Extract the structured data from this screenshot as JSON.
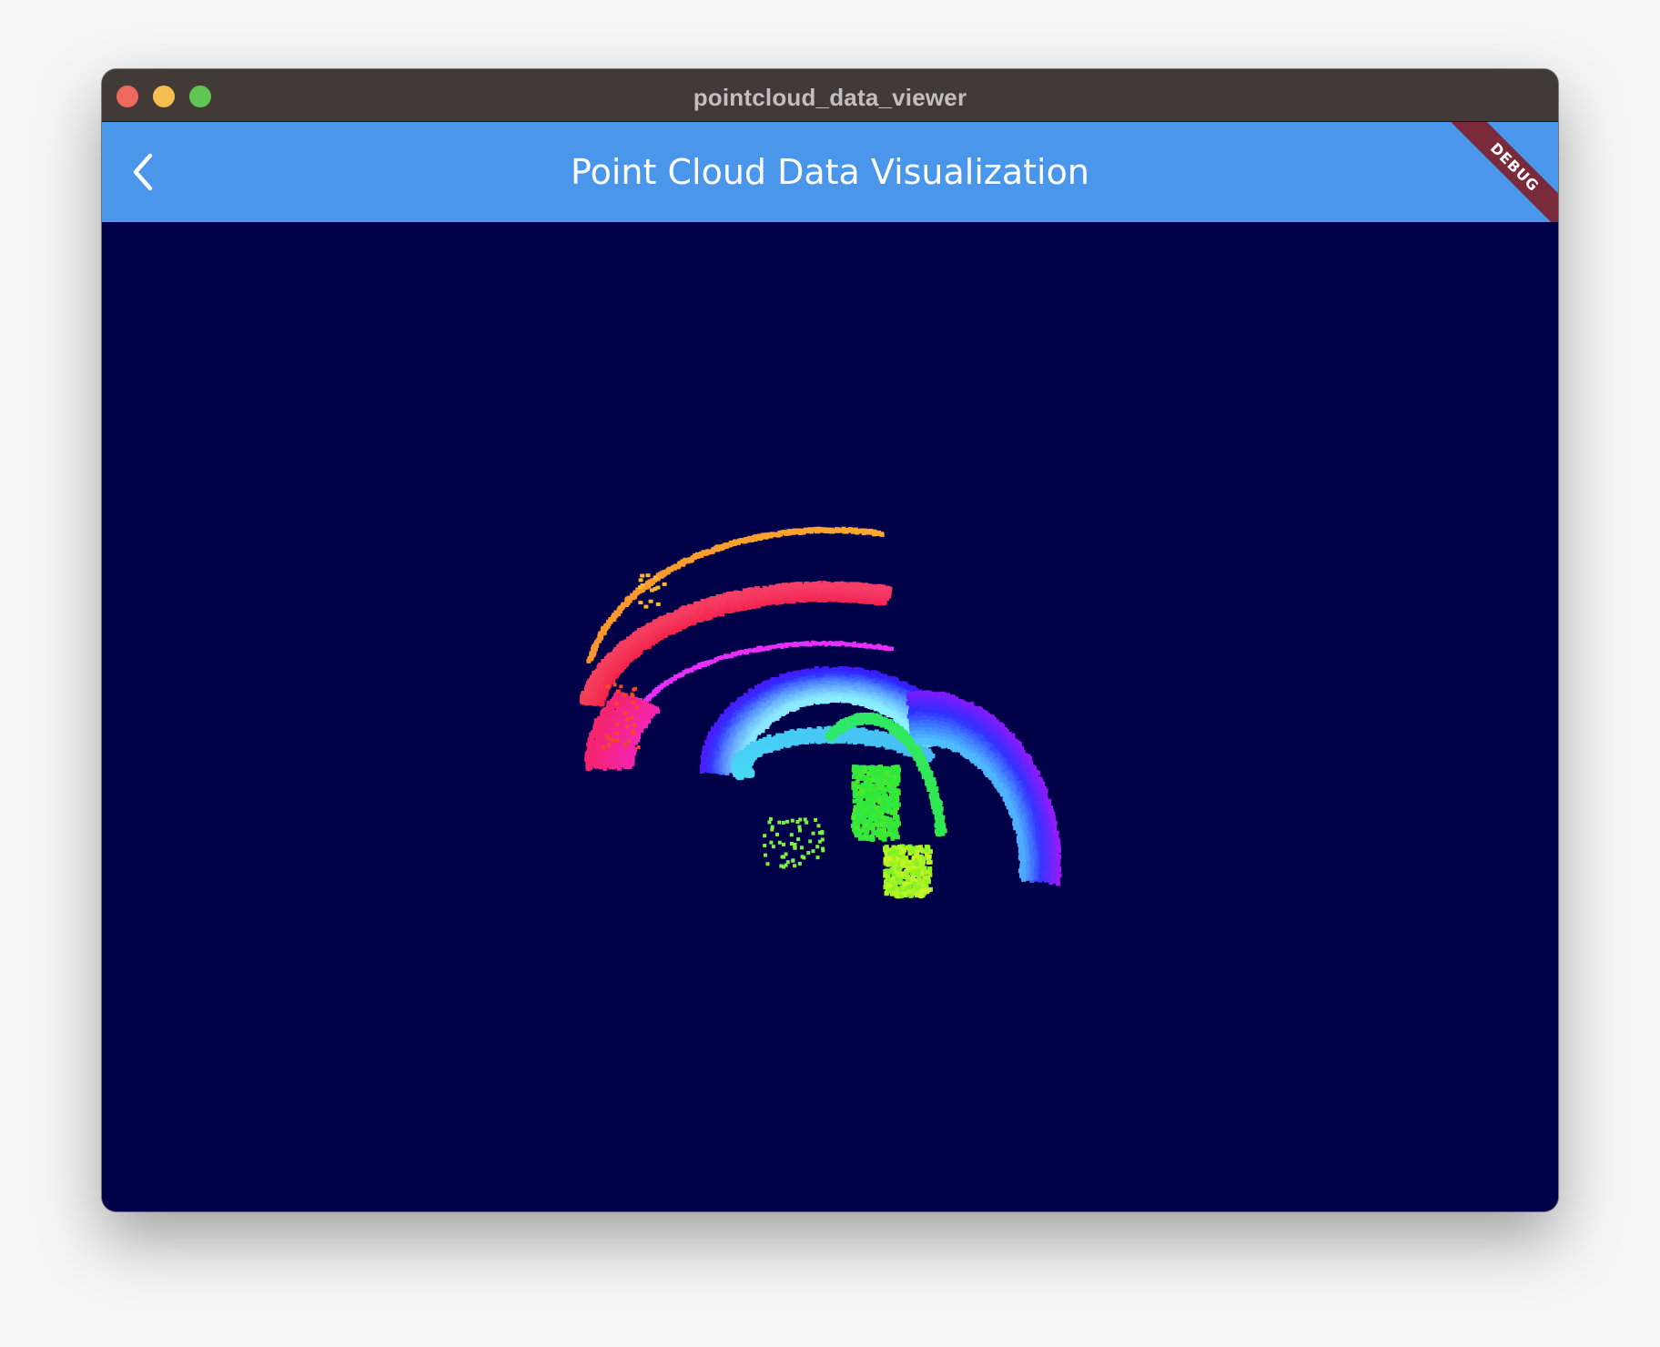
{
  "window": {
    "title": "pointcloud_data_viewer"
  },
  "appbar": {
    "title": "Point Cloud Data Visualization",
    "debug_banner": "DEBUG"
  },
  "icons": {
    "back": "chevron-left-icon"
  },
  "colors": {
    "titlebar": "#423a37",
    "appbar": "#4a96eb",
    "viewport_background": "#000048",
    "debug_banner": "#7a2a3a",
    "close": "#ee6a5f",
    "minimize": "#f5be4f",
    "zoom": "#61c554"
  }
}
